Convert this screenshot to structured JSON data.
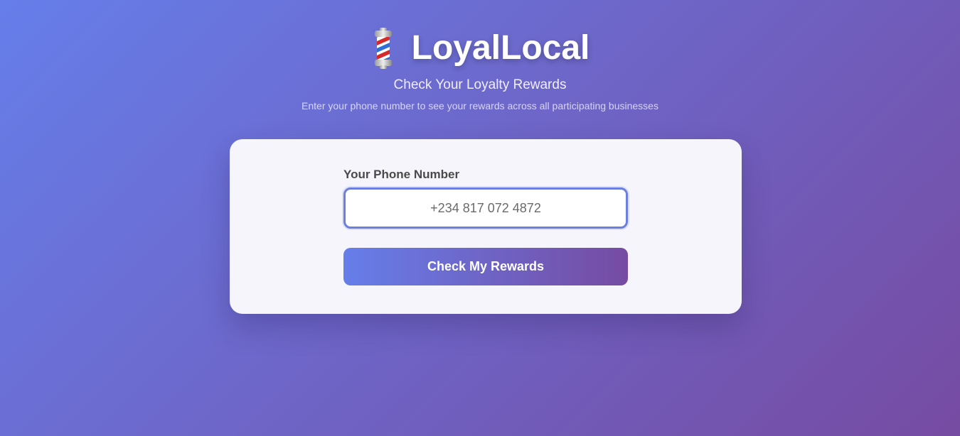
{
  "header": {
    "logo_icon": "barber-pole-icon",
    "title": "LoyalLocal",
    "subtitle": "Check Your Loyalty Rewards",
    "description": "Enter your phone number to see your rewards across all participating businesses"
  },
  "form": {
    "phone_label": "Your Phone Number",
    "phone_value": "+234 817 072 4872",
    "submit_label": "Check My Rewards"
  },
  "colors": {
    "gradient_start": "#667eea",
    "gradient_end": "#764ba2",
    "card_background": "#f6f5fb",
    "input_border": "#6b7fe0"
  }
}
